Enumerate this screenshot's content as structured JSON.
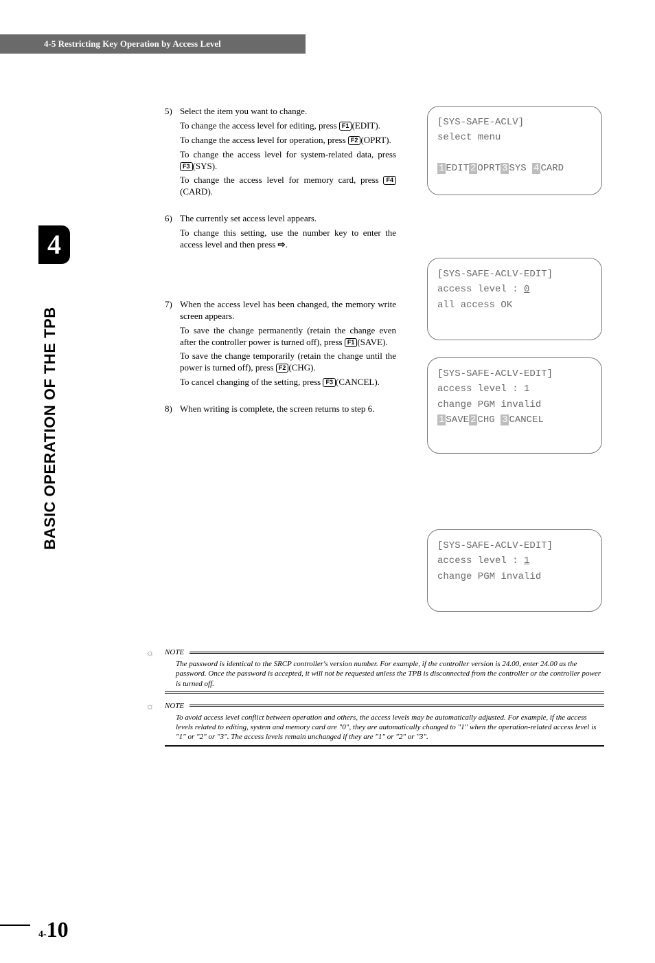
{
  "header": {
    "title": "4-5 Restricting Key Operation by Access Level"
  },
  "tab": {
    "num": "4"
  },
  "side": {
    "title": "BASIC OPERATION OF THE TPB"
  },
  "steps": {
    "s5": {
      "num": "5)",
      "l1": "Select the item you want to change.",
      "l2a": "To change the access level for editing, press ",
      "l2b": "(EDIT).",
      "l3a": "To change the access level for operation, press ",
      "l3b": "(OPRT).",
      "l4a": "To change the access level for system-related data, press ",
      "l4b": "(SYS).",
      "l5a": "To change the access level for memory card, press ",
      "l5b": "(CARD)."
    },
    "s6": {
      "num": "6)",
      "l1": "The currently set access level appears.",
      "l2a": "To change this setting, use the number key to enter the access level and then press ",
      "l2b": "."
    },
    "s7": {
      "num": "7)",
      "l1": "When the access level has been changed, the memory write screen appears.",
      "l2a": "To save the change permanently (retain the change even after the controller power is turned off), press ",
      "l2b": "(SAVE).",
      "l3a": "To save the change temporarily (retain the change until the power is turned off), press ",
      "l3b": "(CHG).",
      "l4a": "To cancel changing of the setting, press ",
      "l4b": "(CANCEL)."
    },
    "s8": {
      "num": "8)",
      "l1": "When writing is complete, the screen returns to step 6."
    }
  },
  "keys": {
    "f1": "F1",
    "f2": "F2",
    "f3": "F3",
    "f4": "F4"
  },
  "icon": {
    "arrow": "⇨"
  },
  "screens": {
    "sc1": {
      "l1": "[SYS-SAFE-ACLV]",
      "l2": "select menu",
      "row": {
        "h1": "1",
        "t1": "EDIT",
        "h2": "2",
        "t2": "OPRT",
        "h3": "3",
        "t3": "SYS ",
        "h4": "4",
        "t4": "CARD"
      }
    },
    "sc2": {
      "l1": "[SYS-SAFE-ACLV-EDIT]",
      "l2a": "access level : ",
      "l2b": "0",
      "l3": "all access OK"
    },
    "sc3": {
      "l1": "[SYS-SAFE-ACLV-EDIT]",
      "l2": "access level : 1",
      "l3": "change PGM invalid",
      "row": {
        "h1": "1",
        "t1": "SAVE",
        "h2": "2",
        "t2": "CHG ",
        "h3": "3",
        "t3": "CANCEL"
      }
    },
    "sc4": {
      "l1": "[SYS-SAFE-ACLV-EDIT]",
      "l2a": "access level : ",
      "l2b": "1",
      "l3": "change PGM invalid"
    }
  },
  "notes": {
    "label": "NOTE",
    "n1": "The password is identical to the SRCP controller's version number. For example, if the controller version is 24.00, enter 24.00 as the password. Once the password is accepted, it will not be requested unless the TPB is disconnected from the controller or the controller power is turned off.",
    "n2": "To avoid access level conflict between operation and others, the access levels may be automatically adjusted. For example, if the access levels related to editing, system and memory card are \"0\", they are automatically changed to \"1\" when the operation-related access level is \"1\" or \"2\" or \"3\". The access levels remain unchanged if they are \"1\" or \"2\" or \"3\"."
  },
  "page": {
    "prefix": "4-",
    "num": "10"
  }
}
